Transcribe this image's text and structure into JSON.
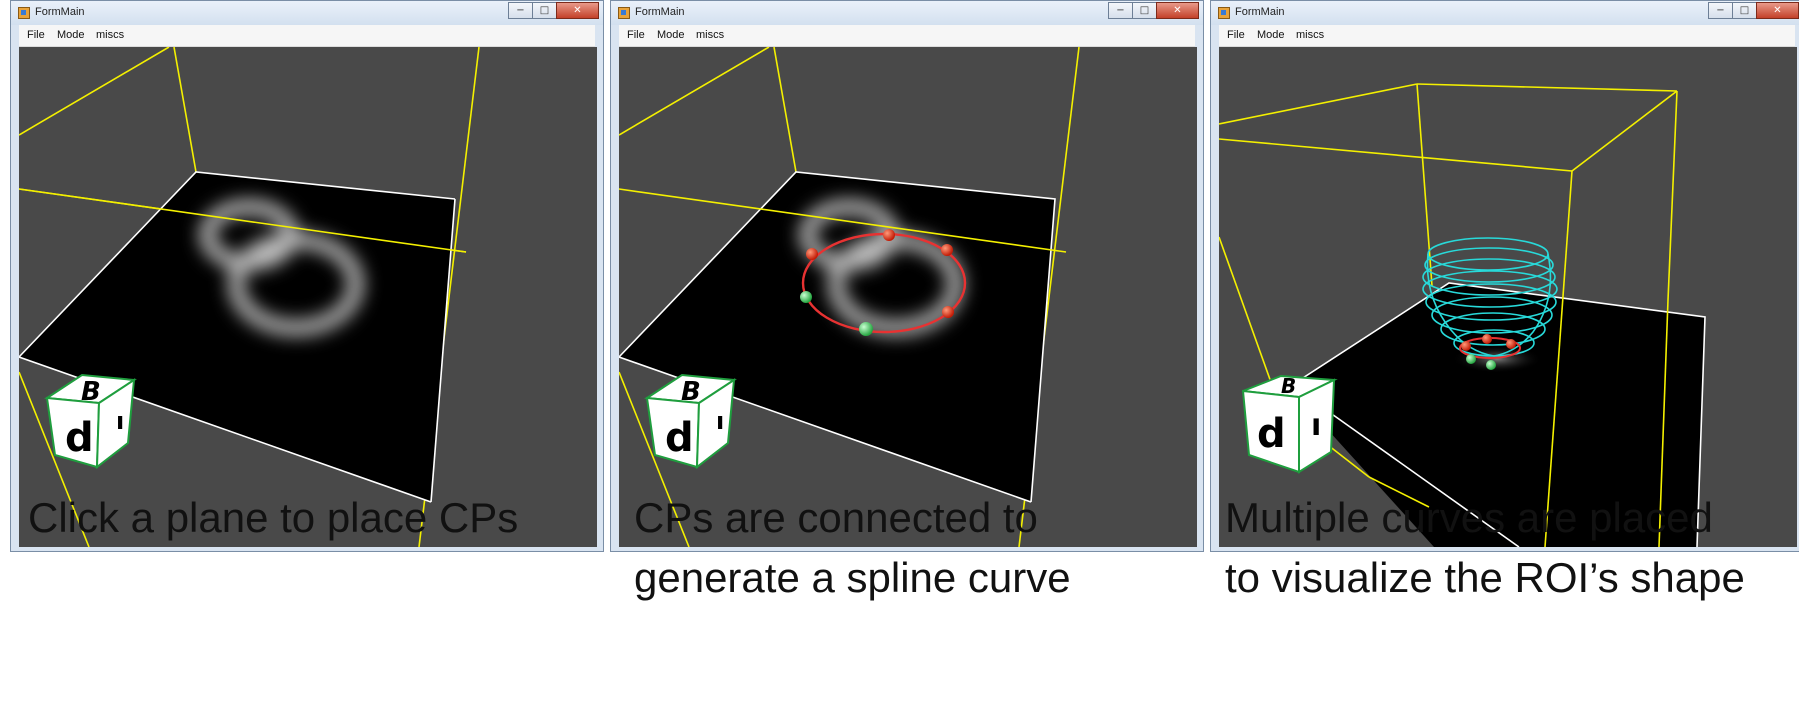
{
  "windows": [
    {
      "title": "FormMain",
      "menu": [
        "File",
        "Mode",
        "miscs"
      ],
      "caption": {
        "line1": "Click a plane to place CPs",
        "line2": ""
      }
    },
    {
      "title": "FormMain",
      "menu": [
        "File",
        "Mode",
        "miscs"
      ],
      "caption": {
        "line1": "CPs are connected to",
        "line2": "generate a spline curve"
      }
    },
    {
      "title": "FormMain",
      "menu": [
        "File",
        "Mode",
        "miscs"
      ],
      "caption": {
        "line1": "Multiple curves are placed",
        "line2": "to visualize the ROI’s shape"
      }
    }
  ],
  "caption_buttons": {
    "minimize": "−",
    "maximize": "□",
    "close": "✕"
  },
  "cube_labels": {
    "top": "B",
    "front": "d",
    "side": "ı"
  },
  "colors": {
    "bounding_box": "#f4f000",
    "plane_edge": "#ffffff",
    "spline_curve": "#e83232",
    "cp_red": "#e02a10",
    "cp_green": "#3fd957",
    "roi_curves": "#28d9d9",
    "cube_edge": "#1f9e3e"
  }
}
